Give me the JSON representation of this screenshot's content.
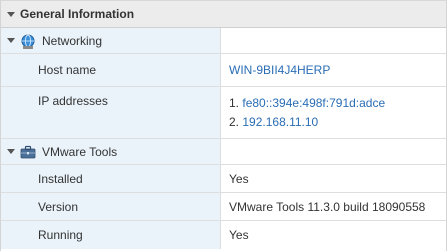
{
  "panel": {
    "title": "General Information"
  },
  "networking": {
    "group_label": "Networking",
    "host_name_label": "Host name",
    "host_name_value": "WIN-9BII4J4HERP",
    "ip_label": "IP addresses",
    "ip_addresses": [
      {
        "index": "1.",
        "address": "fe80::394e:498f:791d:adce"
      },
      {
        "index": "2.",
        "address": "192.168.11.10"
      }
    ]
  },
  "vmware_tools": {
    "group_label": "VMware Tools",
    "installed_label": "Installed",
    "installed_value": "Yes",
    "version_label": "Version",
    "version_value": "VMware Tools 11.3.0 build 18090558",
    "running_label": "Running",
    "running_value": "Yes"
  },
  "icons": {
    "networking": "globe-network-icon",
    "vmware_tools": "toolbox-icon",
    "caret": "caret-down-icon"
  },
  "colors": {
    "label_background": "#eaf3fa",
    "link": "#2a6db5",
    "header_background": "#ececec"
  }
}
